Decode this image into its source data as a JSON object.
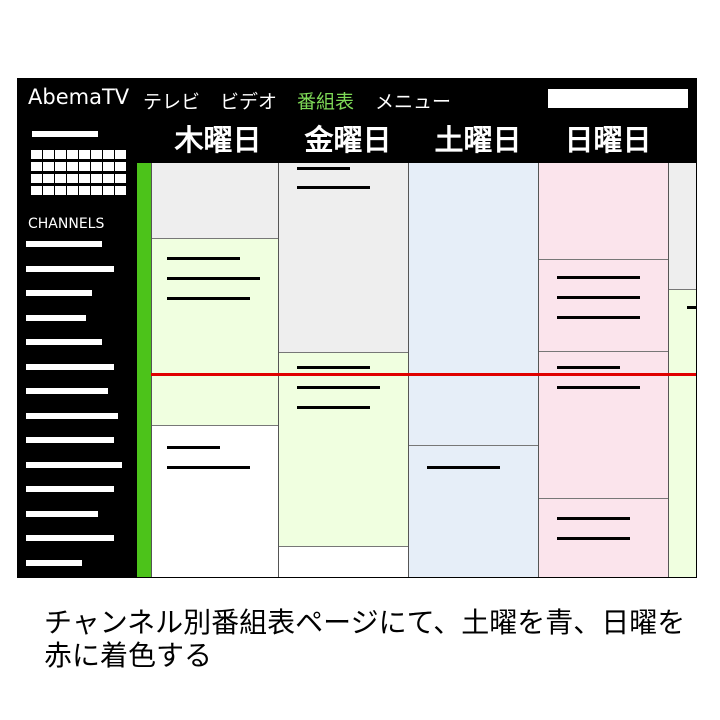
{
  "header": {
    "logo": "AbemaTV",
    "nav": {
      "tv": "テレビ",
      "video": "ビデオ",
      "guide": "番組表",
      "menu": "メニュー"
    },
    "active_nav": "guide",
    "accent_color": "#7ed957"
  },
  "sidebar": {
    "channels_label": "CHANNELS"
  },
  "days": [
    {
      "label": "木曜日",
      "color": "#f0ffe0"
    },
    {
      "label": "金曜日",
      "color": "#eeeeee"
    },
    {
      "label": "土曜日",
      "color": "#e6eef8"
    },
    {
      "label": "日曜日",
      "color": "#fbe4ec"
    }
  ],
  "colors": {
    "now_line": "#e00000",
    "current_channel": "#4cc31a",
    "saturday": "#e6eef8",
    "sunday": "#fbe4ec"
  },
  "caption": "チャンネル別番組表ページにて、土曜を青、日曜を赤に着色する"
}
